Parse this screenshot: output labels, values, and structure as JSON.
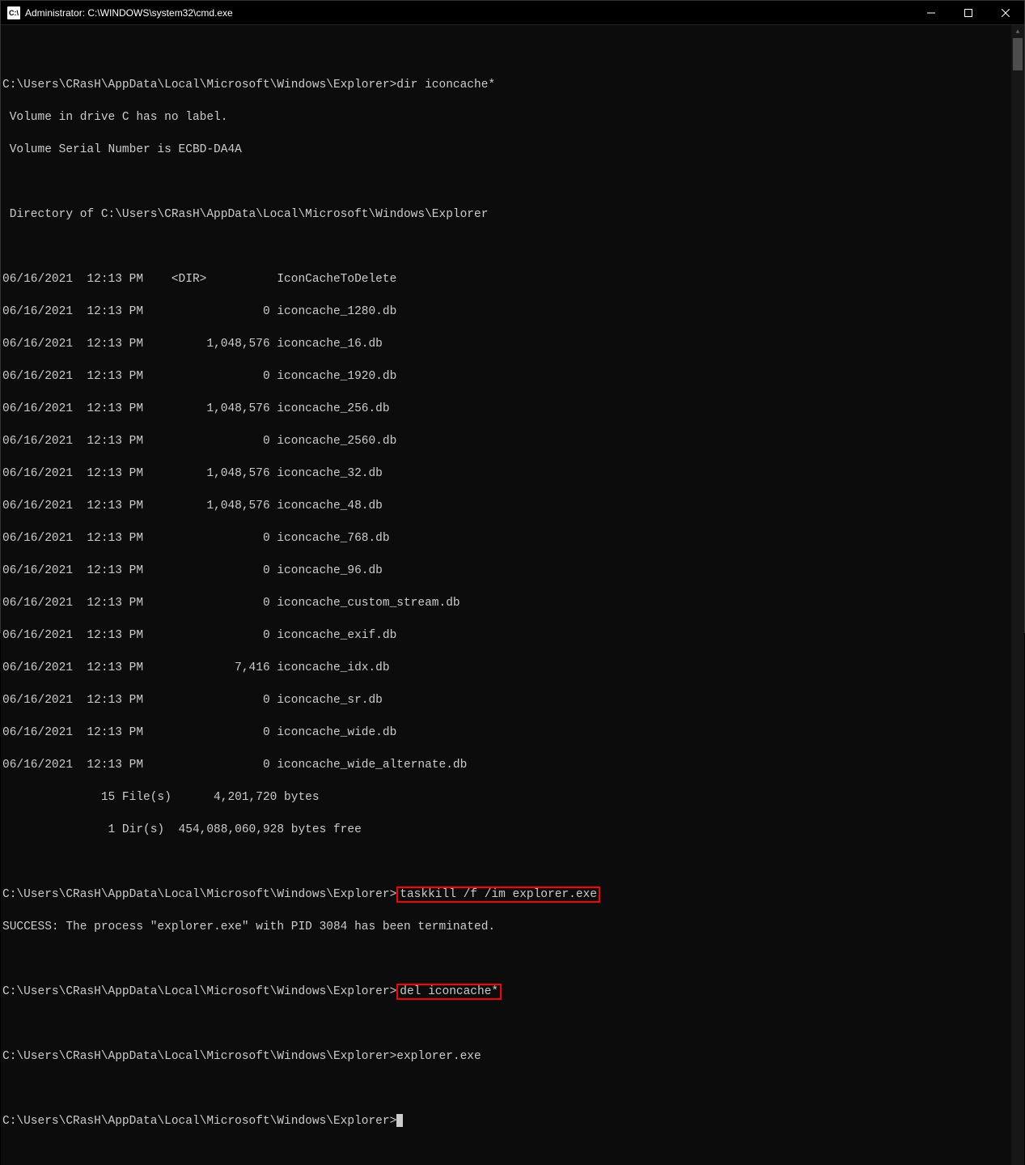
{
  "title": "Administrator: C:\\WINDOWS\\system32\\cmd.exe",
  "prompt_path": "C:\\Users\\CRasH\\AppData\\Local\\Microsoft\\Windows\\Explorer>",
  "cmd_dir": "dir iconcache*",
  "vol_line": " Volume in drive C has no label.",
  "serial_line": " Volume Serial Number is ECBD-DA4A",
  "dirof_line": " Directory of C:\\Users\\CRasH\\AppData\\Local\\Microsoft\\Windows\\Explorer",
  "entries": [
    "06/16/2021  12:13 PM    <DIR>          IconCacheToDelete",
    "06/16/2021  12:13 PM                 0 iconcache_1280.db",
    "06/16/2021  12:13 PM         1,048,576 iconcache_16.db",
    "06/16/2021  12:13 PM                 0 iconcache_1920.db",
    "06/16/2021  12:13 PM         1,048,576 iconcache_256.db",
    "06/16/2021  12:13 PM                 0 iconcache_2560.db",
    "06/16/2021  12:13 PM         1,048,576 iconcache_32.db",
    "06/16/2021  12:13 PM         1,048,576 iconcache_48.db",
    "06/16/2021  12:13 PM                 0 iconcache_768.db",
    "06/16/2021  12:13 PM                 0 iconcache_96.db",
    "06/16/2021  12:13 PM                 0 iconcache_custom_stream.db",
    "06/16/2021  12:13 PM                 0 iconcache_exif.db",
    "06/16/2021  12:13 PM             7,416 iconcache_idx.db",
    "06/16/2021  12:13 PM                 0 iconcache_sr.db",
    "06/16/2021  12:13 PM                 0 iconcache_wide.db",
    "06/16/2021  12:13 PM                 0 iconcache_wide_alternate.db"
  ],
  "summary_files": "              15 File(s)      4,201,720 bytes",
  "summary_dirs": "               1 Dir(s)  454,088,060,928 bytes free",
  "cmd_taskkill": "taskkill /f /im explorer.exe",
  "taskkill_result": "SUCCESS: The process \"explorer.exe\" with PID 3084 has been terminated.",
  "cmd_del": "del iconcache*",
  "cmd_explorer": "explorer.exe"
}
